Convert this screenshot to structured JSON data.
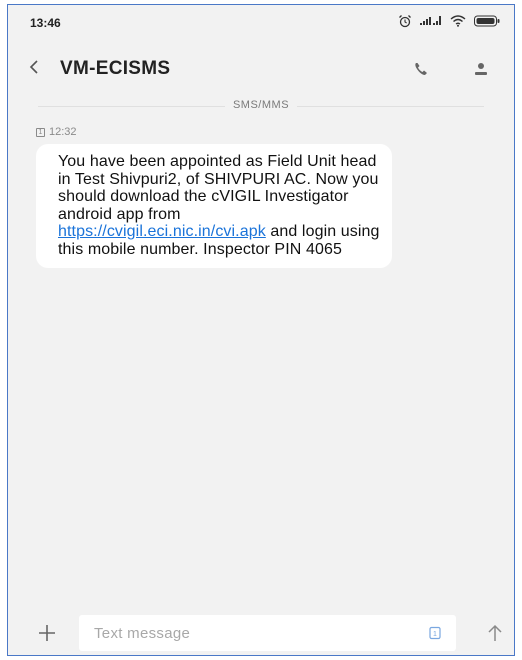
{
  "status_bar": {
    "time": "13:46",
    "icons": [
      "alarm-icon",
      "signal-icon",
      "wifi-icon",
      "battery-icon"
    ]
  },
  "header": {
    "back_icon": "chevron-left-icon",
    "title": "VM-ECISMS",
    "actions": [
      "phone-icon",
      "contact-icon"
    ]
  },
  "conversation": {
    "section_label": "SMS/MMS",
    "messages": [
      {
        "time": "12:32",
        "sim_badge": "1",
        "text_before_link": "You have been appointed as Field Unit head in Test Shivpuri2, of SHIVPURI AC. Now you should download the cVIGIL Investigator android app from ",
        "link": "https://cvigil.eci.nic.in/cvi.apk",
        "text_after_link": " and login using this mobile number. Inspector PIN 4065"
      }
    ]
  },
  "composer": {
    "add_icon": "plus-icon",
    "placeholder": "Text message",
    "value": "",
    "sim_icon": "sim-icon",
    "sim_label": "1",
    "send_icon": "send-arrow-icon"
  },
  "colors": {
    "background": "#f2f2f2",
    "bubble": "#ffffff",
    "link": "#1a73d9",
    "frame_border": "#4a78c7"
  }
}
